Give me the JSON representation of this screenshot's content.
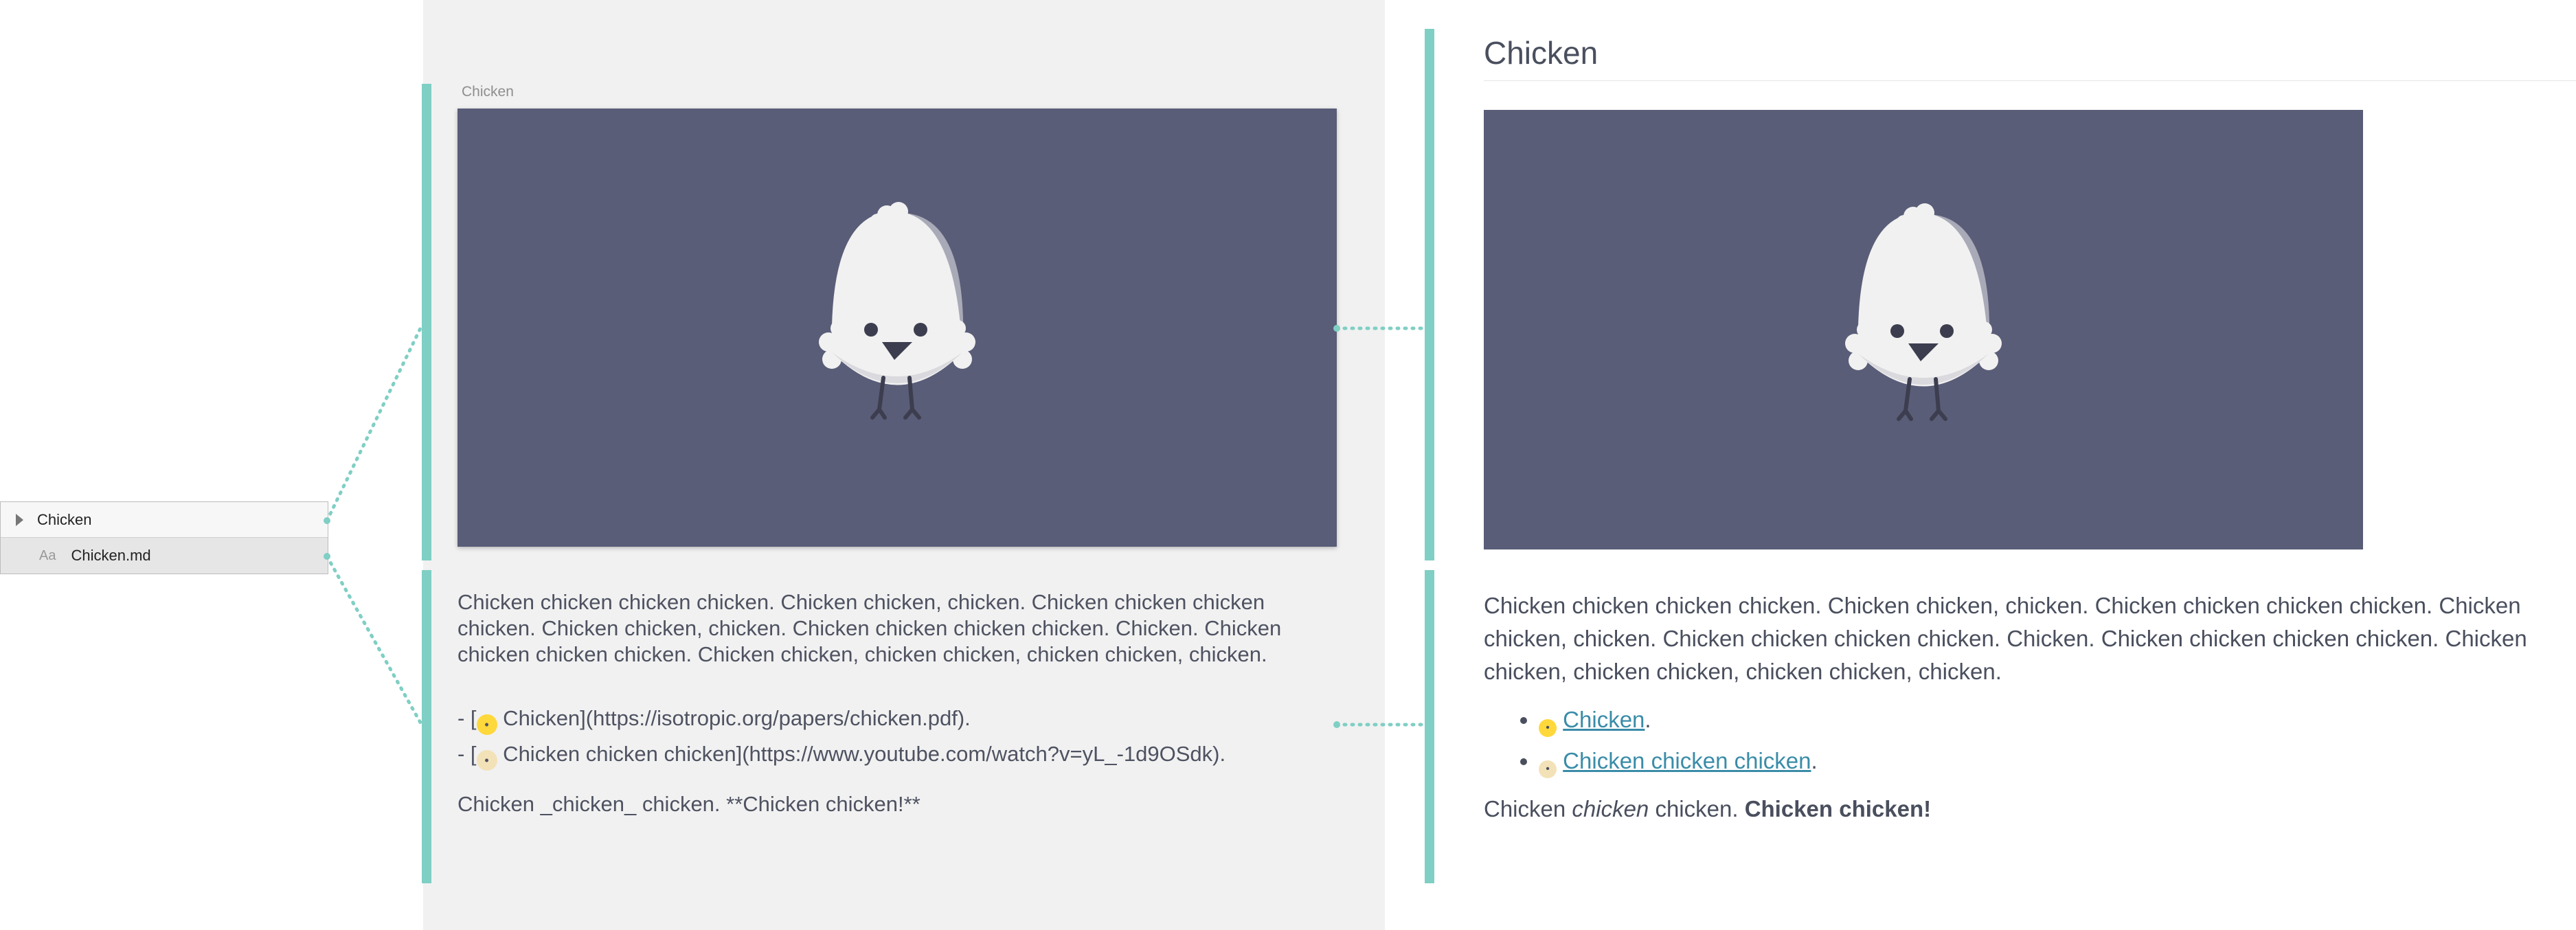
{
  "file_tree": {
    "folder_label": "Chicken",
    "file_icon": "Aa",
    "file_label": "Chicken.md"
  },
  "editor": {
    "image_caption": "Chicken",
    "paragraph": "Chicken chicken chicken chicken. Chicken chicken, chicken. Chicken chicken chicken chicken. Chicken chicken, chicken. Chicken chicken chicken chicken. Chicken. Chicken chicken chicken chicken. Chicken chicken, chicken chicken, chicken chicken, chicken.",
    "list_line_1_prefix": "- [",
    "list_line_1_rest": " Chicken](https://isotropic.org/papers/chicken.pdf).",
    "list_line_2_prefix": "- [",
    "list_line_2_rest": " Chicken chicken chicken](https://www.youtube.com/watch?v=yL_-1d9OSdk).",
    "final_line": "Chicken _chicken_ chicken. **Chicken chicken!**"
  },
  "preview": {
    "title": "Chicken",
    "paragraph": "Chicken chicken chicken chicken. Chicken chicken, chicken. Chicken chicken chicken chicken. Chicken chicken, chicken. Chicken chicken chicken chicken. Chicken. Chicken chicken chicken chicken. Chicken chicken, chicken chicken, chicken chicken, chicken.",
    "link_1": "Chicken",
    "link_2": "Chicken chicken chicken",
    "period": ".",
    "final_plain_1": "Chicken ",
    "final_em": "chicken",
    "final_plain_2": " chicken. ",
    "final_strong": "Chicken chicken!"
  },
  "icons": {
    "emoji_1": "baby-chick-icon",
    "emoji_2": "hatching-chick-icon"
  },
  "colors": {
    "accent_teal": "#7fcfc4",
    "image_background": "#5a5d78",
    "chick_body": "#f1f1f1",
    "link": "#3a8ca8"
  }
}
